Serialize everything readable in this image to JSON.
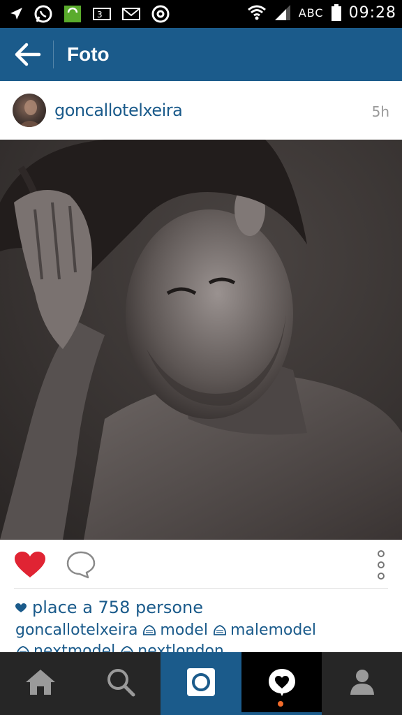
{
  "status_bar": {
    "time": "09:28",
    "carrier_label": "ABC",
    "icons": [
      "navigation-icon",
      "whatsapp-icon",
      "hangouts-icon",
      "network-3g-icon",
      "gmail-icon",
      "opera-icon",
      "wifi-icon",
      "signal-icon",
      "battery-icon"
    ]
  },
  "app_bar": {
    "title": "Foto",
    "back_icon": "arrow-left-icon",
    "background": "#1b5b8b"
  },
  "post": {
    "username": "goncallotelxeira",
    "time_ago": "5h",
    "likes_text": "place a 758 persone",
    "caption": {
      "user": "goncallotelxeira",
      "hashtags": [
        "model",
        "malemodel",
        "nextmodel",
        "nextlondon"
      ]
    }
  },
  "actions": {
    "like_icon": "heart-icon",
    "comment_icon": "comment-icon",
    "more_icon": "more-vertical-icon",
    "like_color": "#e02433"
  },
  "bottom_nav": {
    "items": [
      "home-icon",
      "search-icon",
      "camera-icon",
      "activity-icon",
      "profile-icon"
    ],
    "active": "activity-icon",
    "accent": "#1b5b8b",
    "notification_color": "#f26b2a"
  }
}
